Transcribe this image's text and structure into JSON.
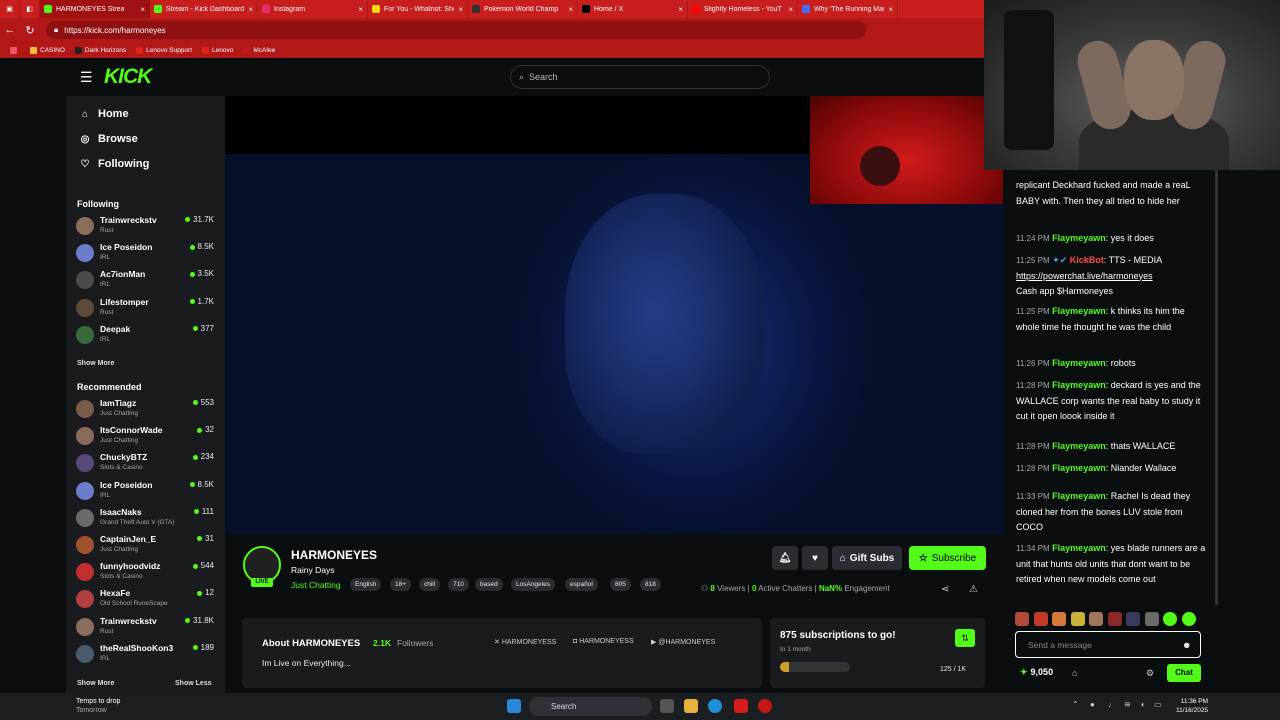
{
  "browser": {
    "tabs": [
      {
        "label": "HARMONEYES Strea",
        "color": "#53fc18",
        "active": true
      },
      {
        "label": "Stream - Kick Dashboard",
        "color": "#53fc18"
      },
      {
        "label": "Instagram",
        "color": "#e1306c"
      },
      {
        "label": "For You - Whatnot: Shop",
        "color": "#f5d90a"
      },
      {
        "label": "Pokemon World Champ",
        "color": "#333333"
      },
      {
        "label": "Home / X",
        "color": "#000000"
      },
      {
        "label": "Slightly Homeless - YouT",
        "color": "#ff0000"
      },
      {
        "label": "Why 'The Running Man'",
        "color": "#4a6cf7"
      }
    ],
    "url": "https://kick.com/harmoneyes",
    "bookmarks": [
      "CASINO",
      "Dark Horizons",
      "Lenovo Support",
      "Lenovo",
      "McAfee"
    ]
  },
  "header": {
    "logo": "KICK",
    "search_placeholder": "Search"
  },
  "sidebar": {
    "nav": [
      {
        "label": "Home",
        "icon": "home-icon"
      },
      {
        "label": "Browse",
        "icon": "compass-icon"
      },
      {
        "label": "Following",
        "icon": "heart-icon"
      }
    ],
    "following_title": "Following",
    "following": [
      {
        "name": "Trainwreckstv",
        "category": "Rust",
        "viewers": "31.7K",
        "color": "#8a6d5a"
      },
      {
        "name": "Ice Poseidon",
        "category": "IRL",
        "viewers": "8.5K",
        "color": "#6b7ec9"
      },
      {
        "name": "Ac7ionMan",
        "category": "IRL",
        "viewers": "3.5K",
        "color": "#4b4b4b"
      },
      {
        "name": "Lifestomper",
        "category": "Rust",
        "viewers": "1.7K",
        "color": "#5e4a3a"
      },
      {
        "name": "Deepak",
        "category": "IRL",
        "viewers": "377",
        "color": "#3a6a3a"
      }
    ],
    "show_more": "Show More",
    "recommended_title": "Recommended",
    "recommended": [
      {
        "name": "IamTiagz",
        "category": "Just Chatting",
        "viewers": "553",
        "color": "#7a5c4a"
      },
      {
        "name": "ItsConnorWade",
        "category": "Just Chatting",
        "viewers": "32",
        "color": "#8a6a5a"
      },
      {
        "name": "ChuckyBTZ",
        "category": "Slots & Casino",
        "viewers": "234",
        "color": "#5a4a7a"
      },
      {
        "name": "Ice Poseidon",
        "category": "IRL",
        "viewers": "8.5K",
        "color": "#6b7ec9"
      },
      {
        "name": "IsaacNaks",
        "category": "Grand Theft Auto V (GTA)",
        "viewers": "111",
        "color": "#6a6a6a"
      },
      {
        "name": "CaptainJen_E",
        "category": "Just Chatting",
        "viewers": "31",
        "color": "#a0522d"
      },
      {
        "name": "funnyhoodvidz",
        "category": "Slots & Casino",
        "viewers": "544",
        "color": "#c03030"
      },
      {
        "name": "HexaFe",
        "category": "Old School RuneScape",
        "viewers": "12",
        "color": "#b04040"
      },
      {
        "name": "Trainwreckstv",
        "category": "Rust",
        "viewers": "31.8K",
        "color": "#8a6d5a"
      },
      {
        "name": "theRealShooKon3",
        "category": "IRL",
        "viewers": "189",
        "color": "#4a5a6a"
      }
    ],
    "show_more_2": "Show More",
    "show_less": "Show Less"
  },
  "channel": {
    "name": "HARMONEYES",
    "live": "LIVE",
    "title": "Rainy Days",
    "category": "Just Chatting",
    "tags": [
      "English",
      "18+",
      "chill",
      "710",
      "based",
      "LosAngeles",
      "español",
      "805",
      "818"
    ],
    "gift_subs": "Gift Subs",
    "subscribe": "Subscribe",
    "viewers_count": "8",
    "viewers_label": "Viewers",
    "chatters_count": "0",
    "chatters_label": "Active Chatters",
    "engagement_value": "NaN%",
    "engagement_label": "Engagement",
    "about_title": "About HARMONEYES",
    "followers_count": "2.1K",
    "followers_label": "Followers",
    "bio": "Im Live on Everything...",
    "socials": [
      "HARMONEYESS",
      "HARMONEYESS",
      "@HARMONEYES"
    ],
    "goal_title": "875 subscriptions to go!",
    "goal_sub": "In 1 month",
    "goal_progress": "125 / 1K",
    "goal_fraction": 0.125
  },
  "chat": {
    "messages": [
      {
        "time": "",
        "user": "",
        "text": "replicant Deckhard fucked and made a reaL BABY with. Then they all tried to hide her"
      },
      {
        "time": "11:24 PM",
        "user": "Flaymeyawn",
        "text": "yes it does"
      },
      {
        "time": "11:25 PM",
        "user": "KickBot",
        "text": "TTS - MEDIA",
        "link": "https://powerchat.live/harmoneyes",
        "extra": "Cash app $Harmoneyes"
      },
      {
        "time": "11:25 PM",
        "user": "Flaymeyawn",
        "text": "k thinks its him the whole time he thought he was the child"
      },
      {
        "time": "11:26 PM",
        "user": "Flaymeyawn",
        "text": "robots"
      },
      {
        "time": "11:28 PM",
        "user": "Flaymeyawn",
        "text": "deckard is yes and the WALLACE corp wants the real baby to study it cut it open loook inside it"
      },
      {
        "time": "11:28 PM",
        "user": "Flaymeyawn",
        "text": "thats WALLACE"
      },
      {
        "time": "11:28 PM",
        "user": "Flaymeyawn",
        "text": "Niander Wallace"
      },
      {
        "time": "11:33 PM",
        "user": "Flaymeyawn",
        "text": "Rachel Is dead they cloned her from the bones LUV stole from COCO"
      },
      {
        "time": "11:34 PM",
        "user": "Flaymeyawn",
        "text": "yes blade runners are a unit that hunts old units that dont want to be retired when new models come out"
      }
    ],
    "input_placeholder": "Send a message",
    "points": "9,050",
    "send_label": "Chat"
  },
  "taskbar": {
    "weather_line1": "Temps to drop",
    "weather_line2": "Tomorrow",
    "search": "Search",
    "time": "11:36 PM",
    "date": "11/16/2025"
  }
}
